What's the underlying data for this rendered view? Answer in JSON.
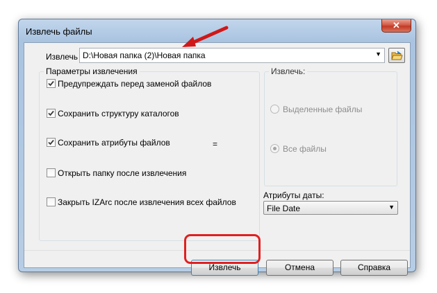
{
  "window": {
    "title": "Извлечь файлы",
    "close_glyph": "✕"
  },
  "extract_to": {
    "label": "Извлечь в:",
    "path": "D:\\Новая папка (2)\\Новая папка",
    "browse_icon": "open-folder-icon"
  },
  "params": {
    "title": "Параметры извлечения",
    "options": [
      {
        "label": "Предупреждать перед заменой файлов",
        "checked": true
      },
      {
        "label": "Сохранить структуру каталогов",
        "checked": true
      },
      {
        "label": "Сохранить атрибуты файлов",
        "checked": true
      },
      {
        "label": "Открыть папку после извлечения",
        "checked": false
      },
      {
        "label": "Закрыть IZArc после извлечения всех файлов",
        "checked": false
      }
    ],
    "equals_mark": "="
  },
  "extract_group": {
    "title": "Извлечь:",
    "options": [
      {
        "label": "Выделенные файлы",
        "selected": false,
        "disabled": true
      },
      {
        "label": "Все файлы",
        "selected": true,
        "disabled": true
      }
    ]
  },
  "date_attrs": {
    "label": "Атрибуты даты:",
    "value": "File Date"
  },
  "buttons": {
    "extract": "Извлечь",
    "cancel": "Отмена",
    "help": "Справка"
  },
  "colors": {
    "frame": "#a9c3e0",
    "highlight": "#e02020",
    "close_button": "#c23a24"
  }
}
